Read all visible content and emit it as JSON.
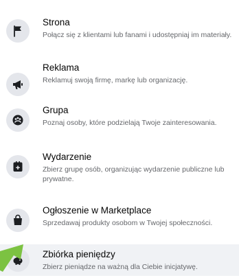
{
  "menu": {
    "items": [
      {
        "title": "Strona",
        "description": "Połącz się z klientami lub fanami i udostępniaj im materiały.",
        "icon": "flag-icon"
      },
      {
        "title": "Reklama",
        "description": "Reklamuj swoją firmę, markę lub organizację.",
        "icon": "megaphone-icon"
      },
      {
        "title": "Grupa",
        "description": "Poznaj osoby, które podzielają Twoje zainteresowania.",
        "icon": "group-icon"
      },
      {
        "title": "Wydarzenie",
        "description": "Zbierz grupę osób, organizując wydarzenie publiczne lub prywatne.",
        "icon": "calendar-plus-icon"
      },
      {
        "title": "Ogłoszenie w Marketplace",
        "description": "Sprzedawaj produkty osobom w Twojej społeczności.",
        "icon": "shopping-bag-icon"
      },
      {
        "title": "Zbiórka pieniędzy",
        "description": "Zbierz pieniądze na ważną dla Ciebie inicjatywę.",
        "icon": "piggy-bank-icon"
      }
    ]
  },
  "colors": {
    "icon_bg": "#e4e6eb",
    "highlight_bg": "#f0f2f5",
    "title_text": "#050505",
    "desc_text": "#65676b",
    "annotation_arrow": "#7cc242"
  }
}
